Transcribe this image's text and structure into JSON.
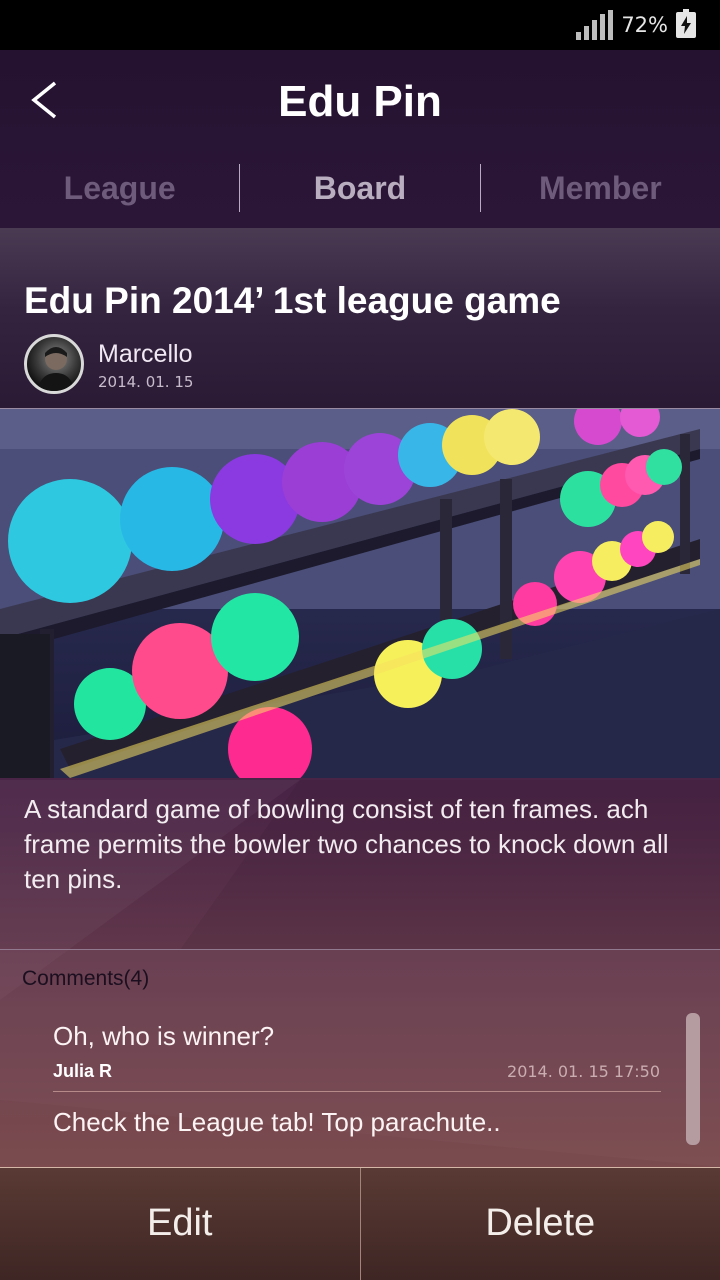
{
  "status_bar": {
    "battery_percent": "72%",
    "icons": [
      "signal-icon",
      "battery-charging-icon"
    ]
  },
  "header": {
    "title": "Edu Pin",
    "back_icon": "chevron-left-icon"
  },
  "tabs": [
    {
      "label": "League",
      "active": false
    },
    {
      "label": "Board",
      "active": true
    },
    {
      "label": "Member",
      "active": false
    }
  ],
  "post": {
    "title": "Edu Pin 2014’ 1st league game",
    "author": "Marcello",
    "date": "2014. 01. 15",
    "image": "bowling-balls-photo",
    "body": "A standard game of bowling consist of ten frames.  ach frame permits the bowler two chances to knock down all ten pins."
  },
  "comments": {
    "title": "Comments(4)",
    "items": [
      {
        "text": "Oh, who is winner?",
        "author": "Julia R",
        "date": "2014. 01. 15 17:50"
      },
      {
        "text": "Check the League tab! Top parachute.."
      }
    ]
  },
  "actions": {
    "edit_label": "Edit",
    "delete_label": "Delete"
  },
  "colors": {
    "header_bg": "#2c1638",
    "active_tab": "#b9aec0",
    "inactive_tab": "#6e5a7a",
    "bottom_bar": "#4a2e2a"
  }
}
